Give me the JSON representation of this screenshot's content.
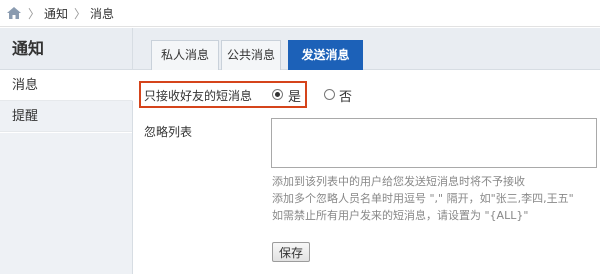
{
  "breadcrumb": {
    "home_icon": "home-icon",
    "separator": "〉",
    "items": [
      "通知",
      "消息"
    ]
  },
  "sidebar": {
    "title": "通知",
    "items": [
      {
        "label": "消息",
        "active": true
      },
      {
        "label": "提醒",
        "active": false
      }
    ]
  },
  "tabs": [
    {
      "label": "私人消息",
      "active": false
    },
    {
      "label": "公共消息",
      "active": false
    },
    {
      "label": "发送消息",
      "active": true
    }
  ],
  "form": {
    "only_friends_label": "只接收好友的短消息",
    "options": [
      {
        "label": "是",
        "checked": true
      },
      {
        "label": "否",
        "checked": false
      }
    ],
    "ignore_list_label": "忽略列表",
    "ignore_list_value": "",
    "help_lines": [
      "添加到该列表中的用户给您发送短消息时将不予接收",
      "添加多个忽略人员名单时用逗号 \",\" 隔开，如\"张三,李四,王五\"",
      "如需禁止所有用户发来的短消息，请设置为 \"{ALL}\""
    ],
    "save_label": "保存"
  },
  "colors": {
    "accent": "#1c61b8",
    "highlight_border": "#d5441b",
    "sidebar_bg": "#eef1f5"
  }
}
